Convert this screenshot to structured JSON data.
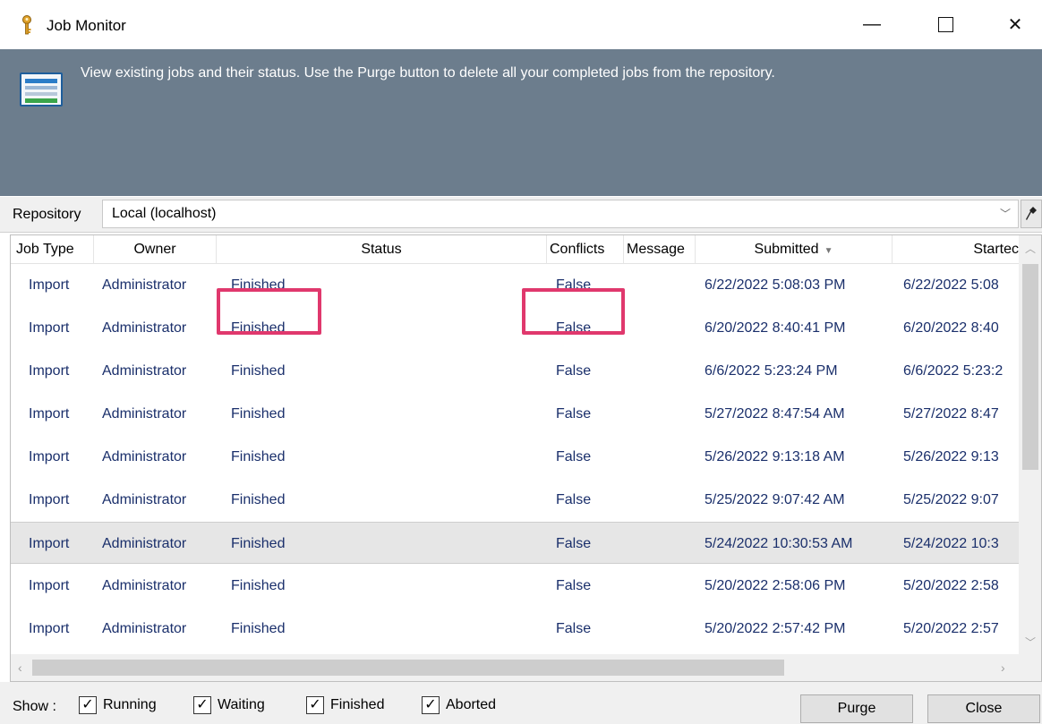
{
  "window": {
    "title": "Job Monitor",
    "icon": "key-icon",
    "controls": {
      "minimize": "—",
      "close": "✕"
    }
  },
  "banner": {
    "icon": "job-monitor-icon",
    "text": "View existing jobs and their status. Use the Purge button to delete all your completed jobs from the repository."
  },
  "repository": {
    "label": "Repository",
    "value": "Local  (localhost)",
    "connect_icon": "plug-icon"
  },
  "table": {
    "columns": [
      "Job Type",
      "Owner",
      "Status",
      "Conflicts",
      "Message",
      "Submitted",
      "Startec"
    ],
    "sorted_column": "Submitted",
    "rows": [
      [
        "Import",
        "Administrator",
        "Finished",
        "False",
        "",
        "6/22/2022 5:08:03 PM",
        "6/22/2022 5:08"
      ],
      [
        "Import",
        "Administrator",
        "Finished",
        "False",
        "",
        "6/20/2022 8:40:41 PM",
        "6/20/2022 8:40"
      ],
      [
        "Import",
        "Administrator",
        "Finished",
        "False",
        "",
        "6/6/2022 5:23:24 PM",
        "6/6/2022 5:23:2"
      ],
      [
        "Import",
        "Administrator",
        "Finished",
        "False",
        "",
        "5/27/2022 8:47:54 AM",
        "5/27/2022 8:47"
      ],
      [
        "Import",
        "Administrator",
        "Finished",
        "False",
        "",
        "5/26/2022 9:13:18 AM",
        "5/26/2022 9:13"
      ],
      [
        "Import",
        "Administrator",
        "Finished",
        "False",
        "",
        "5/25/2022 9:07:42 AM",
        "5/25/2022 9:07"
      ],
      [
        "Import",
        "Administrator",
        "Finished",
        "False",
        "",
        "5/24/2022 10:30:53 AM",
        "5/24/2022 10:3"
      ],
      [
        "Import",
        "Administrator",
        "Finished",
        "False",
        "",
        "5/20/2022 2:58:06 PM",
        "5/20/2022 2:58"
      ],
      [
        "Import",
        "Administrator",
        "Finished",
        "False",
        "",
        "5/20/2022 2:57:42 PM",
        "5/20/2022 2:57"
      ]
    ],
    "selected_row": 6,
    "highlight_color": "#e0386d"
  },
  "footer": {
    "show_label": "Show :",
    "filters": [
      {
        "label": "Running",
        "checked": true
      },
      {
        "label": "Waiting",
        "checked": true
      },
      {
        "label": "Finished",
        "checked": true
      },
      {
        "label": "Aborted",
        "checked": true
      }
    ],
    "purge_label": "Purge",
    "close_label": "Close"
  }
}
